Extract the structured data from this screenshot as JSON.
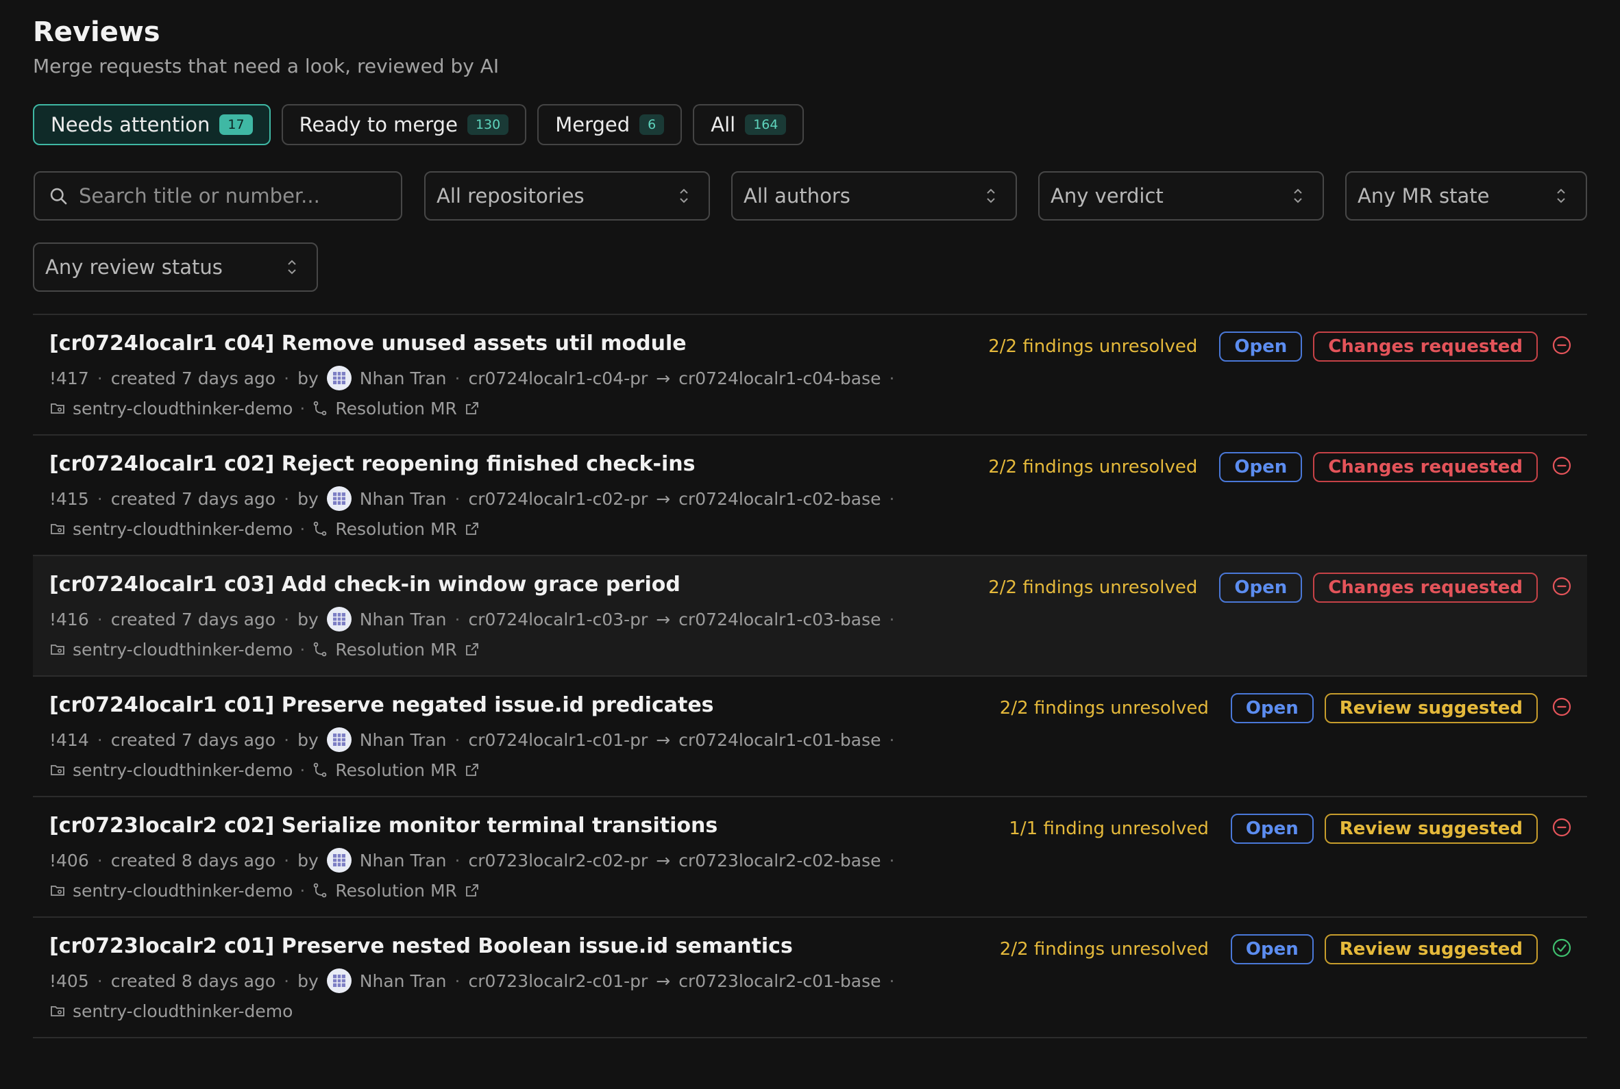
{
  "header": {
    "title": "Reviews",
    "subtitle": "Merge requests that need a look, reviewed by AI"
  },
  "tabs": [
    {
      "label": "Needs attention",
      "count": "17"
    },
    {
      "label": "Ready to merge",
      "count": "130"
    },
    {
      "label": "Merged",
      "count": "6"
    },
    {
      "label": "All",
      "count": "164"
    }
  ],
  "filters": {
    "search_placeholder": "Search title or number...",
    "repositories": "All repositories",
    "authors": "All authors",
    "verdict": "Any verdict",
    "mr_state": "Any MR state",
    "review_status": "Any review status"
  },
  "colors": {
    "accent": "#3fb8a4",
    "findings": "#e5b93b",
    "open": "#5c8df0",
    "changes_requested": "#e4545a",
    "review_suggested": "#e5b93b",
    "resolved": "#3fbf6e"
  },
  "reviews": [
    {
      "title": "[cr0724localr1 c04] Remove unused assets util module",
      "number": "!417",
      "created": "created 7 days ago",
      "by": "by",
      "author": "Nhan Tran",
      "source_branch": "cr0724localr1-c04-pr",
      "target_branch": "cr0724localr1-c04-base",
      "repository": "sentry-cloudthinker-demo",
      "resolution_link": "Resolution MR",
      "findings": "2/2 findings unresolved",
      "state": "Open",
      "verdict": "Changes requested",
      "status_icon": "minus-circle-icon"
    },
    {
      "title": "[cr0724localr1 c02] Reject reopening finished check-ins",
      "number": "!415",
      "created": "created 7 days ago",
      "by": "by",
      "author": "Nhan Tran",
      "source_branch": "cr0724localr1-c02-pr",
      "target_branch": "cr0724localr1-c02-base",
      "repository": "sentry-cloudthinker-demo",
      "resolution_link": "Resolution MR",
      "findings": "2/2 findings unresolved",
      "state": "Open",
      "verdict": "Changes requested",
      "status_icon": "minus-circle-icon"
    },
    {
      "title": "[cr0724localr1 c03] Add check-in window grace period",
      "number": "!416",
      "created": "created 7 days ago",
      "by": "by",
      "author": "Nhan Tran",
      "source_branch": "cr0724localr1-c03-pr",
      "target_branch": "cr0724localr1-c03-base",
      "repository": "sentry-cloudthinker-demo",
      "resolution_link": "Resolution MR",
      "findings": "2/2 findings unresolved",
      "state": "Open",
      "verdict": "Changes requested",
      "status_icon": "minus-circle-icon"
    },
    {
      "title": "[cr0724localr1 c01] Preserve negated issue.id predicates",
      "number": "!414",
      "created": "created 7 days ago",
      "by": "by",
      "author": "Nhan Tran",
      "source_branch": "cr0724localr1-c01-pr",
      "target_branch": "cr0724localr1-c01-base",
      "repository": "sentry-cloudthinker-demo",
      "resolution_link": "Resolution MR",
      "findings": "2/2 findings unresolved",
      "state": "Open",
      "verdict": "Review suggested",
      "status_icon": "minus-circle-icon"
    },
    {
      "title": "[cr0723localr2 c02] Serialize monitor terminal transitions",
      "number": "!406",
      "created": "created 8 days ago",
      "by": "by",
      "author": "Nhan Tran",
      "source_branch": "cr0723localr2-c02-pr",
      "target_branch": "cr0723localr2-c02-base",
      "repository": "sentry-cloudthinker-demo",
      "resolution_link": "Resolution MR",
      "findings": "1/1 finding unresolved",
      "state": "Open",
      "verdict": "Review suggested",
      "status_icon": "minus-circle-icon"
    },
    {
      "title": "[cr0723localr2 c01] Preserve nested Boolean issue.id semantics",
      "number": "!405",
      "created": "created 8 days ago",
      "by": "by",
      "author": "Nhan Tran",
      "source_branch": "cr0723localr2-c01-pr",
      "target_branch": "cr0723localr2-c01-base",
      "repository": "sentry-cloudthinker-demo",
      "resolution_link": "",
      "findings": "2/2 findings unresolved",
      "state": "Open",
      "verdict": "Review suggested",
      "status_icon": "check-circle-icon"
    }
  ]
}
